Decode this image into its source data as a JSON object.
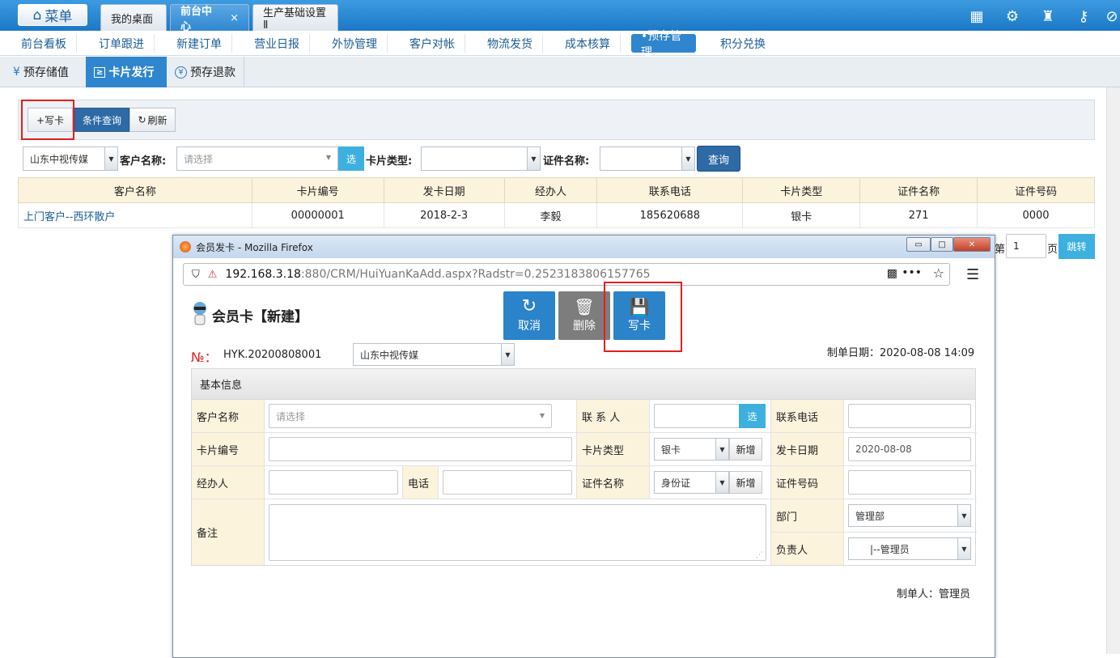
{
  "topbar": {
    "menu_label": "菜单",
    "tabs": [
      {
        "label": "我的桌面"
      },
      {
        "label": "前台中心",
        "close": "×"
      },
      {
        "label": "生产基础设置Ⅱ"
      }
    ]
  },
  "nav2": {
    "items": [
      "前台看板",
      "订单跟进",
      "新建订单",
      "营业日报",
      "外协管理",
      "客户对帐",
      "物流发货",
      "成本核算",
      "•预存管理",
      "积分兑换"
    ]
  },
  "nav3": {
    "items": [
      {
        "icon": "¥",
        "label": "预存储值"
      },
      {
        "icon": "≥",
        "label": "卡片发行"
      },
      {
        "icon": "¥",
        "label": "预存退款"
      }
    ]
  },
  "toolbar": {
    "write_card": "+写卡",
    "query_cond": "条件查询",
    "refresh": "刷新"
  },
  "filter": {
    "company": "山东中视传媒",
    "customer_label": "客户名称:",
    "customer_placeholder": "请选择",
    "select_btn": "选",
    "card_type_label": "卡片类型:",
    "cert_label": "证件名称:",
    "query_btn": "查询"
  },
  "table": {
    "headers": [
      "客户名称",
      "卡片编号",
      "发卡日期",
      "经办人",
      "联系电话",
      "卡片类型",
      "证件名称",
      "证件号码"
    ],
    "rows": [
      [
        "上门客户--西环散户",
        "00000001",
        "2018-2-3",
        "李毅",
        "185620688",
        "银卡",
        "271",
        "0000"
      ]
    ]
  },
  "pager": {
    "prefix": "第",
    "page": "1",
    "suffix": "页",
    "jump": "跳转"
  },
  "popup": {
    "title": "会员发卡 - Mozilla Firefox",
    "url_host": "192.168.3.18",
    "url_rest": ":880/CRM/HuiYuanKaAdd.aspx?Radstr=0.2523183806157765",
    "form_title": "会员卡【新建】",
    "buttons": {
      "cancel": "取消",
      "delete": "删除",
      "write": "写卡"
    },
    "no_label": "№：",
    "no_value": "HYK.20200808001",
    "company": "山东中视传媒",
    "date_label": "制单日期：2020-08-08 14:09",
    "section": "基本信息",
    "fields": {
      "customer_label": "客户名称",
      "customer_placeholder": "请选择",
      "contact_label": "联 系 人",
      "contact_btn": "选",
      "phone_label": "联系电话",
      "card_no_label": "卡片编号",
      "card_type_label": "卡片类型",
      "card_type_value": "银卡",
      "add_btn": "新增",
      "issue_date_label": "发卡日期",
      "issue_date_value": "2020-08-08",
      "handler_label": "经办人",
      "tel_label": "电话",
      "cert_label": "证件名称",
      "cert_value": "身份证",
      "cert_no_label": "证件号码",
      "remark_label": "备注",
      "dept_label": "部门",
      "dept_value": "管理部",
      "owner_label": "负责人",
      "owner_value": "|--管理员"
    },
    "maker": "制单人：管理员"
  }
}
